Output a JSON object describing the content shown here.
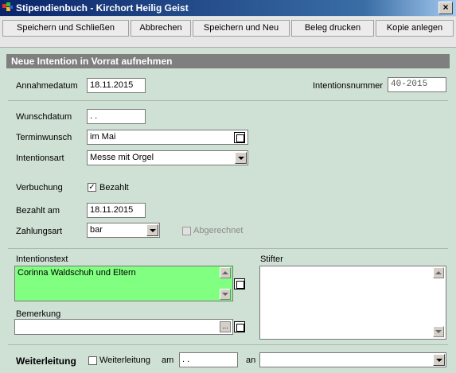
{
  "window": {
    "title": "Stipendienbuch - Kirchort Heilig Geist",
    "close_glyph": "×"
  },
  "toolbar": {
    "save_close": "Speichern und Schließen",
    "cancel": "Abbrechen",
    "save_new": "Speichern und Neu",
    "print_receipt": "Beleg drucken",
    "create_copy": "Kopie anlegen"
  },
  "section": {
    "title": "Neue Intention in Vorrat aufnehmen"
  },
  "form": {
    "annahmedatum_label": "Annahmedatum",
    "annahmedatum_value": "18.11.2015",
    "intentionsnummer_label": "Intentionsnummer",
    "intentionsnummer_value": "40-2015",
    "wunschdatum_label": "Wunschdatum",
    "wunschdatum_value": ". .",
    "terminwunsch_label": "Terminwunsch",
    "terminwunsch_value": "im Mai",
    "intentionsart_label": "Intentionsart",
    "intentionsart_value": "Messe mit Orgel",
    "verbuchung_label": "Verbuchung",
    "bezahlt_label": "Bezahlt",
    "bezahlt_checked": true,
    "bezahlt_am_label": "Bezahlt am",
    "bezahlt_am_value": "18.11.2015",
    "zahlungsart_label": "Zahlungsart",
    "zahlungsart_value": "bar",
    "abgerechnet_label": "Abgerechnet",
    "intentionstext_label": "Intentionstext",
    "intentionstext_value": "Corinna Waldschuh und Eltern",
    "stifter_label": "Stifter",
    "stifter_value": "",
    "bemerkung_label": "Bemerkung",
    "bemerkung_value": "",
    "weiterleitung_label": "Weiterleitung",
    "weiterleitung_chk_label": "Weiterleitung",
    "am_label": "am",
    "weiterleitung_date": ". .",
    "an_label": "an",
    "an_value": ""
  },
  "colors": {
    "background": "#cfe0d4",
    "highlight_field": "#80ff80",
    "section_header": "#7f7f7f"
  }
}
